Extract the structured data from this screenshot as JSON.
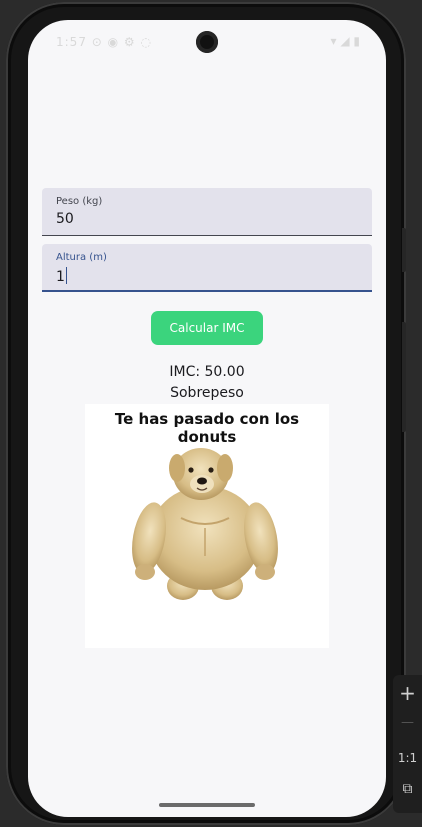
{
  "status_bar": {
    "left_text": "1:57 ⊙ ◉ ⚙ ◌",
    "right_text": "▾ ◢ ▮"
  },
  "form": {
    "weight_field": {
      "label": "Peso (kg)",
      "value": "50"
    },
    "height_field": {
      "label": "Altura (m)",
      "value": "1"
    }
  },
  "actions": {
    "calculate_label": "Calcular IMC"
  },
  "result": {
    "bmi_text": "IMC: 50.00",
    "category_text": "Sobrepeso"
  },
  "meme": {
    "caption": "Te has pasado con los donuts"
  },
  "emulator_toolbar": {
    "zoom_in": "+",
    "zoom_out": "—",
    "ratio": "1:1",
    "fit": "⧉"
  },
  "colors": {
    "button": "#3bd47d",
    "focused_field_indicator": "#36538e",
    "field_background": "#e3e2ec",
    "screen_background": "#f7f7f9"
  }
}
